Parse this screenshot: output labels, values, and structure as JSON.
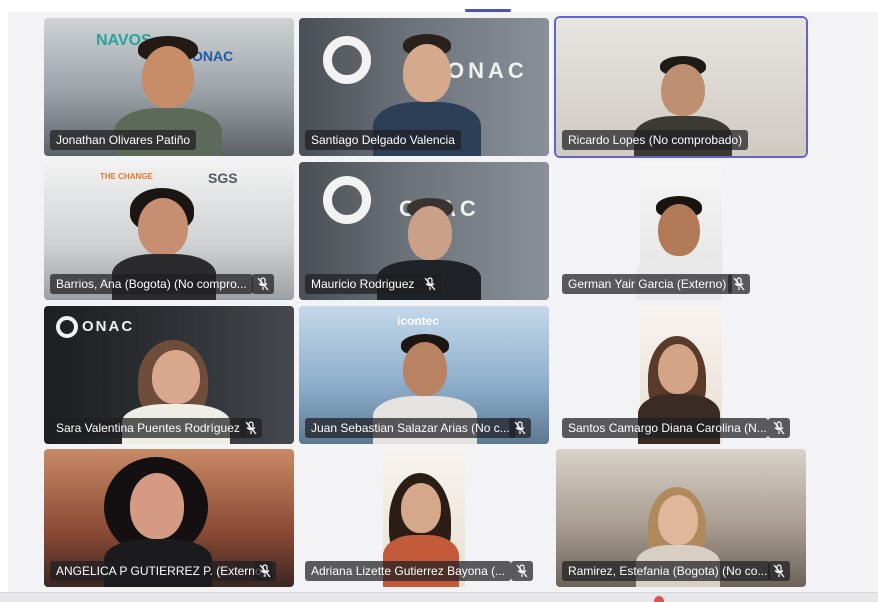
{
  "participants": [
    {
      "name": "Jonathan Olivares Patiño",
      "muted": false
    },
    {
      "name": "Santiago Delgado Valencia",
      "muted": false,
      "logo": "ONAC"
    },
    {
      "name": "Ricardo Lopes (No comprobado)",
      "muted": false,
      "active": true
    },
    {
      "name": "Barrios, Ana (Bogota) (No compro...",
      "muted": true,
      "logo": "SGS"
    },
    {
      "name": "Mauricio Rodriguez",
      "muted": true,
      "logo": "ONAC"
    },
    {
      "name": "German Yair Garcia (Externo)",
      "muted": true
    },
    {
      "name": "Sara Valentina Puentes Rodríguez",
      "muted": true,
      "logo": "ONAC"
    },
    {
      "name": "Juan Sebastian Salazar Arias (No c...",
      "muted": true,
      "logo": "icontec"
    },
    {
      "name": "Santos Camargo Diana Carolina (N...",
      "muted": true
    },
    {
      "name": "ANGELICA P GUTIERREZ P. (Externo)",
      "muted": true
    },
    {
      "name": "Adriana Lizette Gutierrez Bayona (...",
      "muted": true
    },
    {
      "name": "Ramirez, Estefania (Bogota) (No co...",
      "muted": true
    }
  ],
  "colors": {
    "active_border": "#6264c7",
    "badge_bg": "#1e1e22"
  },
  "icons": {
    "mute": "mic-off-icon"
  }
}
